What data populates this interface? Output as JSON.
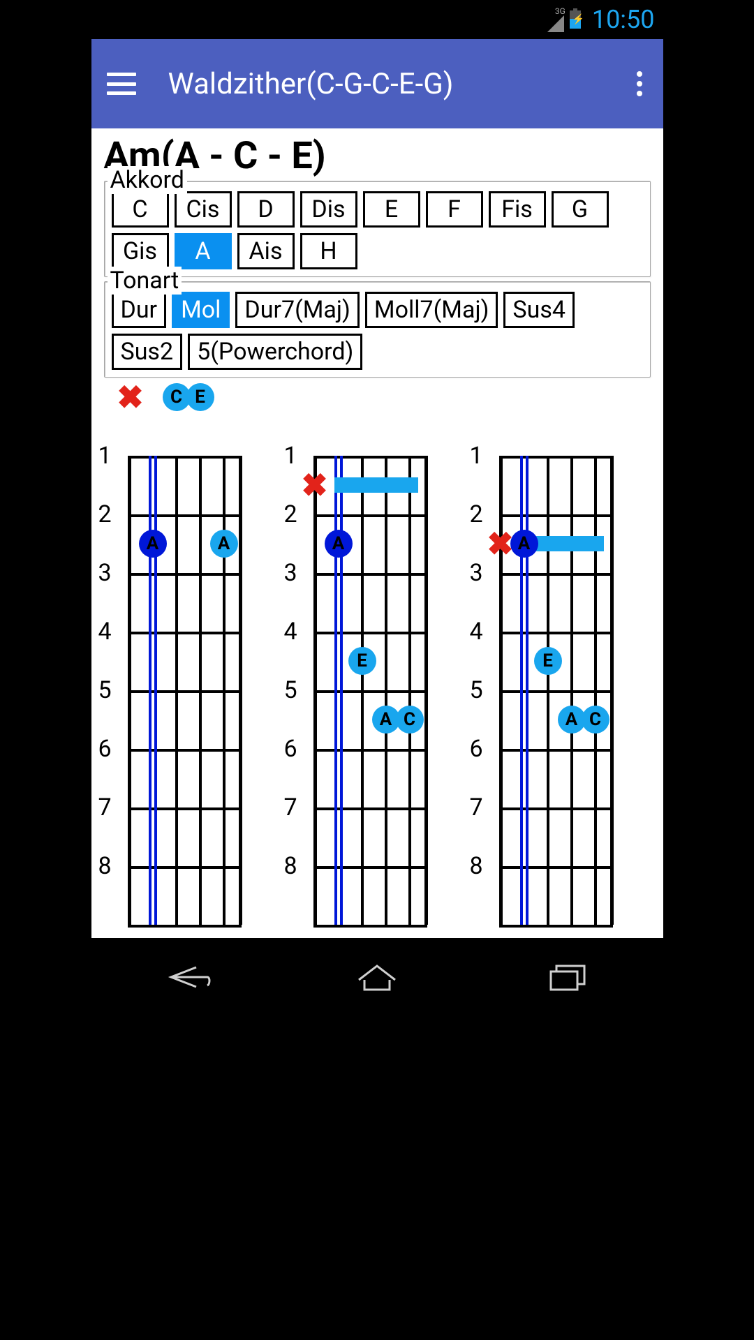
{
  "status": {
    "network_label": "3G",
    "time": "10:50"
  },
  "appbar": {
    "title": "Waldzither(C-G-C-E-G)"
  },
  "chord_title": "Am(A - C - E)",
  "akkord": {
    "legend": "Akkord",
    "notes": [
      "C",
      "Cis",
      "D",
      "Dis",
      "E",
      "F",
      "Fis",
      "G",
      "Gis",
      "A",
      "Ais",
      "H"
    ],
    "selected": "A"
  },
  "tonart": {
    "legend": "Tonart",
    "types": [
      "Dur",
      "Mol",
      "Dur7(Maj)",
      "Moll7(Maj)",
      "Sus4",
      "Sus2",
      "5(Powerchord)"
    ],
    "selected": "Mol"
  },
  "chart_data": {
    "type": "table",
    "instrument": "Waldzither",
    "tuning": [
      "C",
      "G",
      "C",
      "E",
      "G"
    ],
    "fret_labels": [
      1,
      2,
      3,
      4,
      5,
      6,
      7,
      8
    ],
    "open_string_markers": [
      {
        "string": 1,
        "mark": "X"
      },
      {
        "string": 3,
        "mark": "C"
      },
      {
        "string": 4,
        "mark": "E"
      }
    ],
    "diagrams": [
      {
        "id": 1,
        "fingers": [
          {
            "string": 1,
            "fret": 2,
            "note": "A",
            "color": "dark"
          },
          {
            "string": 4,
            "fret": 2,
            "note": "A",
            "color": "cyan"
          }
        ],
        "mutes": [],
        "barres": []
      },
      {
        "id": 2,
        "fingers": [
          {
            "string": 1,
            "fret": 2,
            "note": "A",
            "color": "dark"
          },
          {
            "string": 2,
            "fret": 4,
            "note": "E",
            "color": "cyan"
          },
          {
            "string": 3,
            "fret": 5,
            "note": "A",
            "color": "cyan"
          },
          {
            "string": 4,
            "fret": 5,
            "note": "C",
            "color": "cyan"
          }
        ],
        "mutes": [
          {
            "string": 0,
            "fret": 1
          }
        ],
        "barres": [
          {
            "fret": 1,
            "from_string": 1,
            "to_string": 4
          }
        ]
      },
      {
        "id": 3,
        "fingers": [
          {
            "string": 1,
            "fret": 2,
            "note": "A",
            "color": "dark"
          },
          {
            "string": 2,
            "fret": 4,
            "note": "E",
            "color": "cyan"
          },
          {
            "string": 3,
            "fret": 5,
            "note": "A",
            "color": "cyan"
          },
          {
            "string": 4,
            "fret": 5,
            "note": "C",
            "color": "cyan"
          }
        ],
        "mutes": [
          {
            "string": 0,
            "fret": 2
          }
        ],
        "barres": [
          {
            "fret": 2,
            "from_string": 1,
            "to_string": 4
          }
        ]
      }
    ]
  }
}
